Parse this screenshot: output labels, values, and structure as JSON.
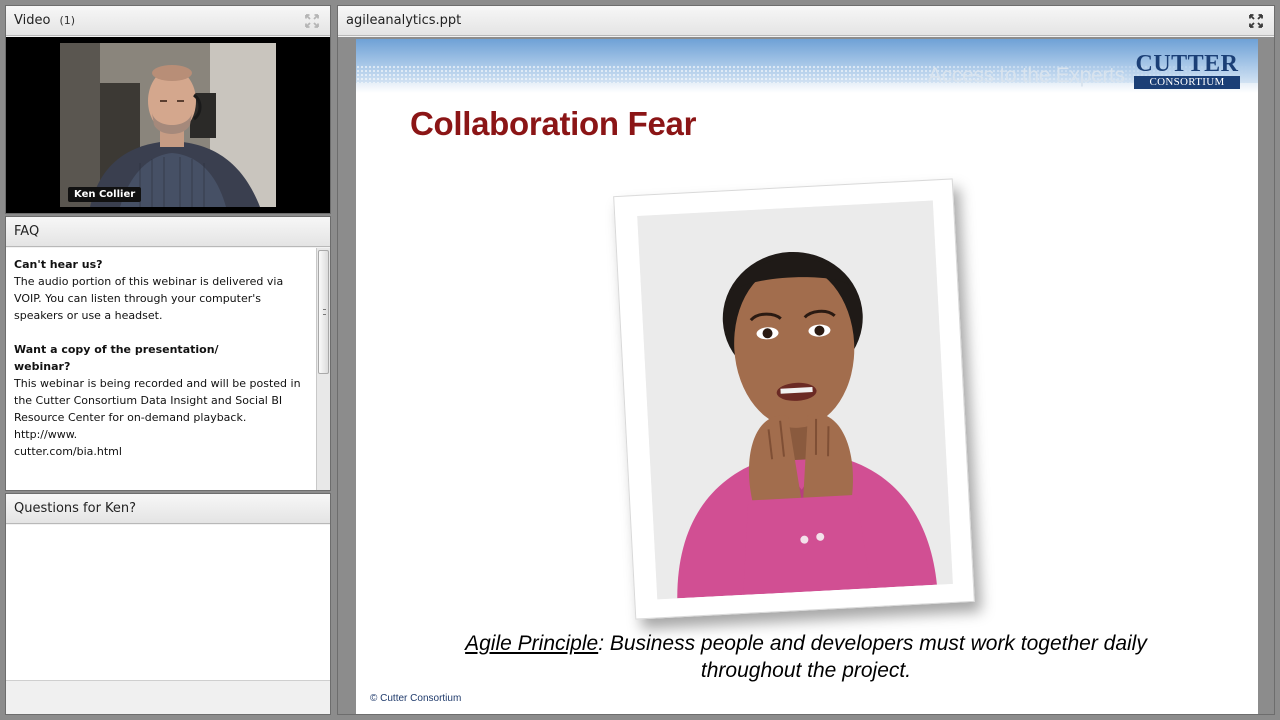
{
  "video_pod": {
    "title": "Video",
    "count": "(1)",
    "presenter_name": "Ken Collier"
  },
  "faq_pod": {
    "title": "FAQ",
    "sections": [
      {
        "question": "Can't hear us?",
        "answer": "The audio portion of this webinar is delivered via VOIP.  You can listen through your computer's speakers or use a headset."
      },
      {
        "question_line1": "Want a copy of the presentation/",
        "question_line2": "webinar?",
        "answer": "This webinar is being recorded and will be posted in the Cutter Consortium Data Insight and Social BI Resource Center for on-demand playback.",
        "link_line1": "http://www.",
        "link_line2": "cutter.com/bia.html"
      }
    ]
  },
  "questions_pod": {
    "title": "Questions for Ken?"
  },
  "slide_pod": {
    "title": "agileanalytics.ppt",
    "slide": {
      "tagline": "Access to the Experts",
      "logo_top": "CUTTER",
      "logo_bottom": "CONSORTIUM",
      "heading": "Collaboration Fear",
      "caption_term": "Agile Principle",
      "caption_rest": ": Business people and developers must work together daily throughout the project.",
      "footer": "© Cutter Consortium"
    }
  },
  "icons": {
    "maximize": "maximize-icon"
  },
  "colors": {
    "slide_title": "#8b1516",
    "logo_blue": "#1b3f76",
    "chrome_gray": "#8c8c8c"
  }
}
